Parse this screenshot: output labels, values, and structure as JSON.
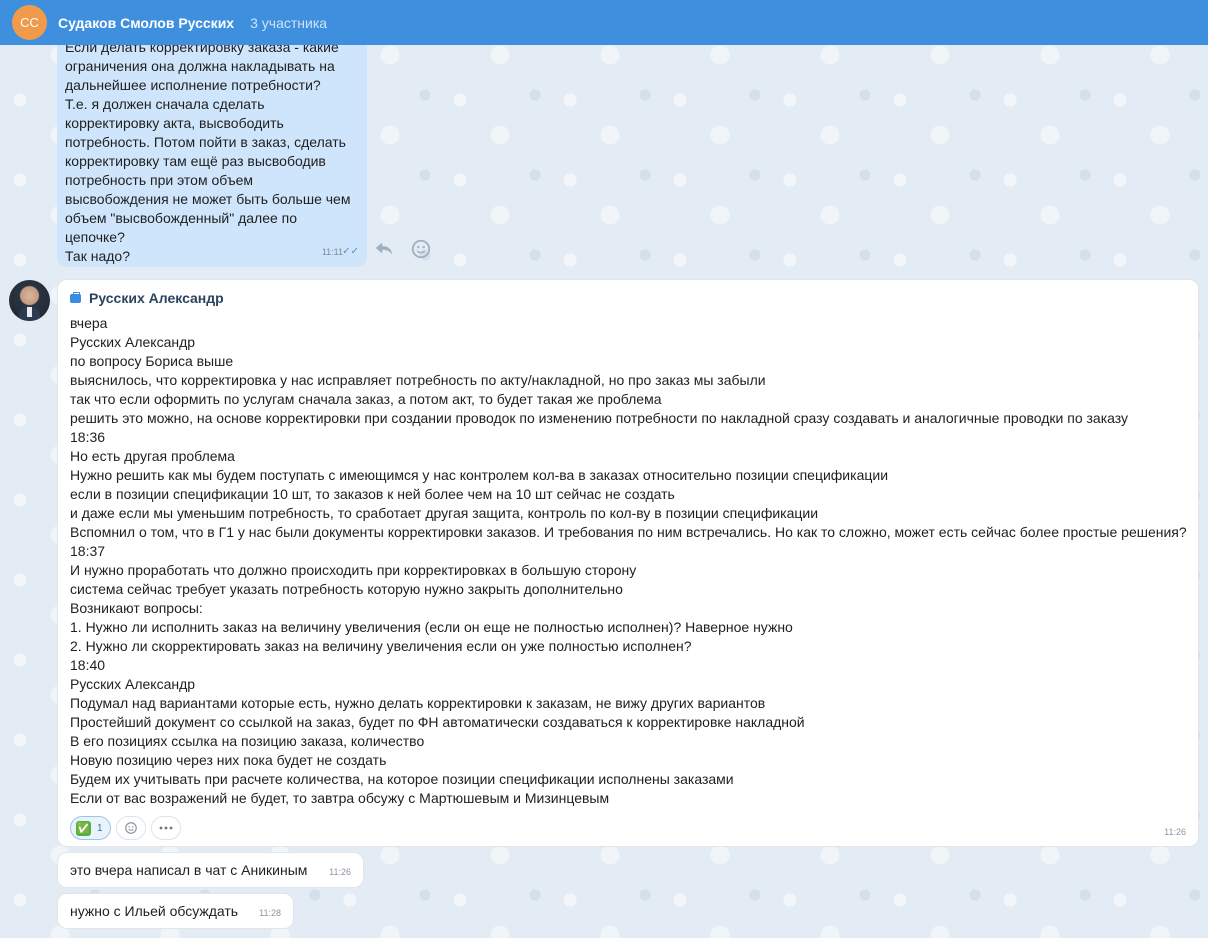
{
  "header": {
    "avatar_initials": "СС",
    "title": "Судаков Смолов Русских",
    "members": "3 участника",
    "color": "#3e8fde"
  },
  "own_message": {
    "text": "Если делать корректировку заказа - какие\nограничения она должна накладывать на\nдальнейшее исполнение потребности?\nТ.е. я должен сначала сделать\nкорректировку акта, высвободить\nпотребность. Потом пойти в заказ, сделать\nкорректировку там ещё раз высвободив\nпотребность при этом объем\nвысвобождения не может быть больше чем\nобъем \"высвобожденный\" далее по\nцепочке?\nТак надо?",
    "time": "11:11",
    "status": "read"
  },
  "main_message": {
    "sender": "Русских Александр",
    "lines": [
      "вчера",
      "Русских Александр",
      "по вопросу Бориса выше",
      "выяснилось, что корректировка у нас исправляет потребность по акту/накладной, но про заказ мы забыли",
      "так что если оформить по услугам сначала заказ, а потом акт, то будет такая же проблема",
      "решить это можно, на основе корректировки при создании проводок по изменению потребности по накладной сразу создавать и аналогичные проводки по заказу",
      "18:36",
      "Но есть другая проблема",
      "Нужно решить как мы будем поступать с имеющимся у нас контролем кол-ва в заказах относительно позиции спецификации",
      "если в позиции спецификации 10 шт, то заказов к ней более чем на 10 шт сейчас не создать",
      "и даже если мы уменьшим потребность, то сработает другая защита, контроль по кол-ву в позиции спецификации",
      "Вспомнил о том, что в Г1 у нас были документы корректировки заказов. И требования по ним встречались. Но как то сложно, может есть сейчас более простые решения?",
      "18:37",
      "И нужно проработать что должно происходить при корректировках в большую сторону",
      "система сейчас требует указать потребность которую нужно закрыть дополнительно",
      "Возникают вопросы:",
      "1. Нужно ли исполнить заказ на величину увеличения (если он еще не полностью исполнен)? Наверное нужно",
      "2. Нужно ли скорректировать заказ на величину увеличения если он уже полностью исполнен?",
      "18:40",
      "Русских Александр",
      "Подумал над вариантами которые есть, нужно делать корректировки к заказам, не вижу других вариантов",
      "Простейший документ со ссылкой на заказ, будет по ФН автоматически создаваться к корректировке накладной",
      "В его позициях ссылка на позицию заказа, количество",
      "Новую позицию через них пока будет не создать",
      "Будем их учитывать при расчете количества, на которое позиции спецификации исполнены заказами",
      "Если от вас возражений не будет, то завтра обсужу с Мартюшевым и Мизинцевым"
    ],
    "reaction": {
      "emoji": "✅",
      "count": "1"
    },
    "time": "11:26"
  },
  "small_messages": [
    {
      "text": "это вчера написал в чат с Аникиным",
      "time": "11:26"
    },
    {
      "text": "нужно с Ильей обсуждать",
      "time": "11:28"
    }
  ]
}
